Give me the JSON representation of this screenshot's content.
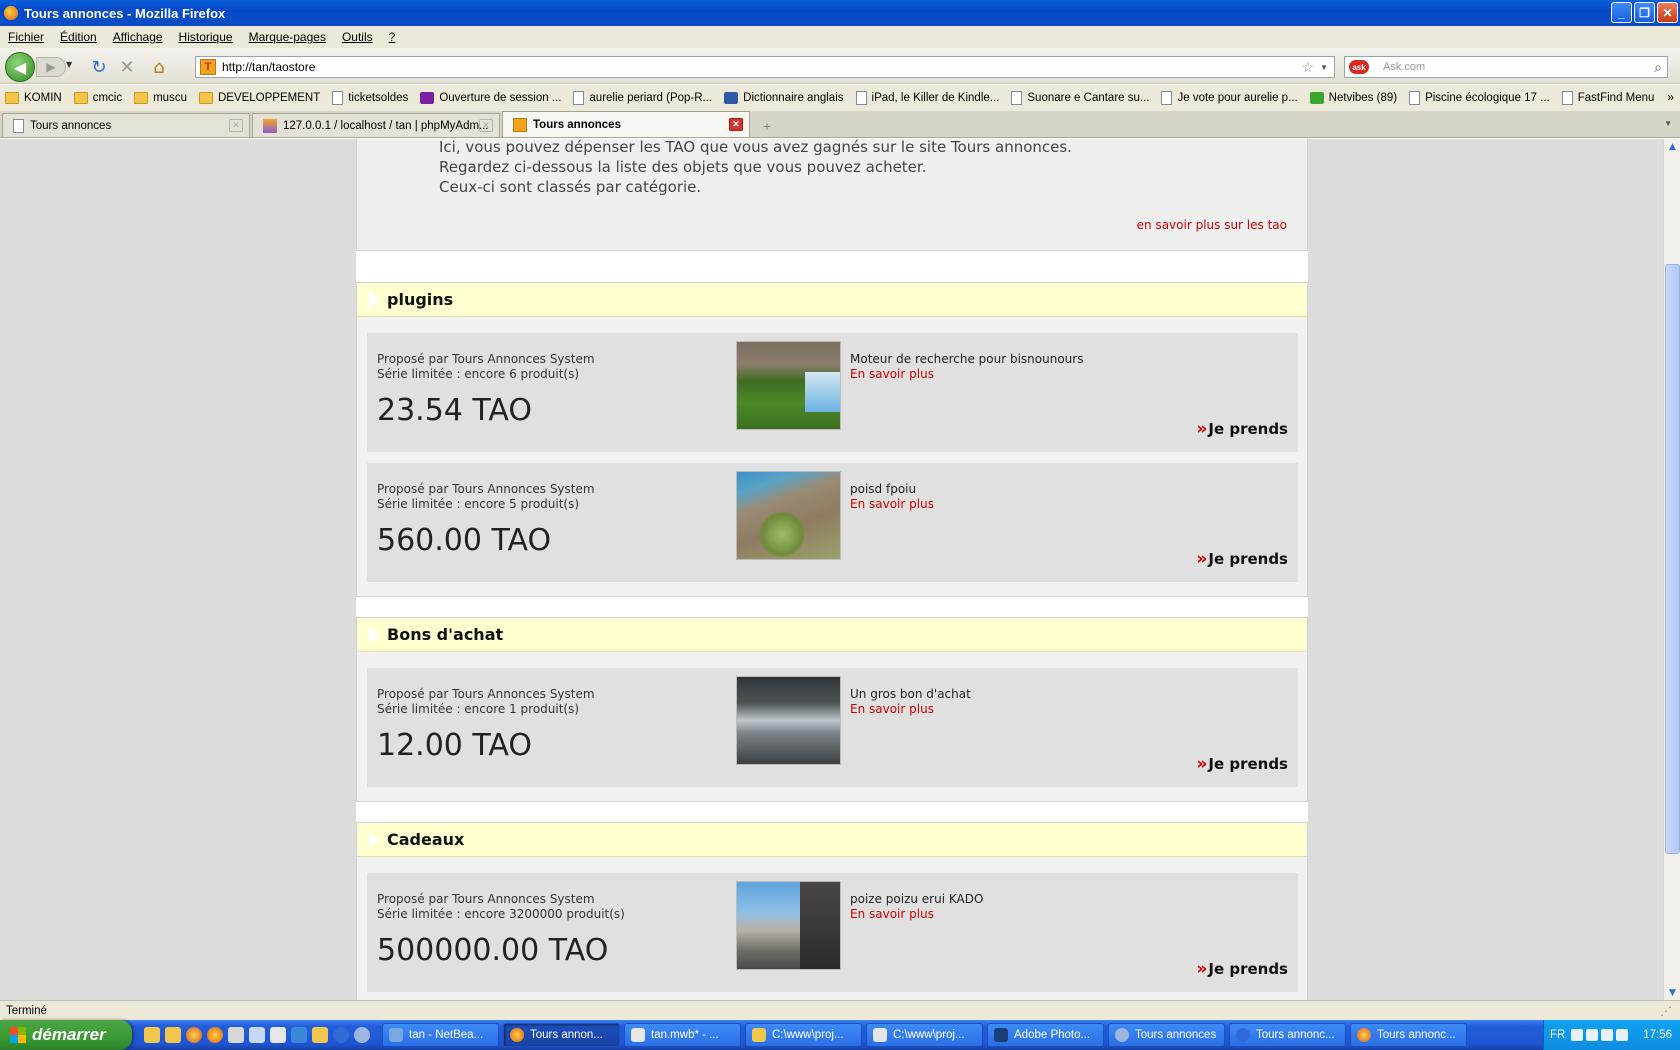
{
  "window": {
    "title": "Tours annonces - Mozilla Firefox"
  },
  "menu": [
    "Fichier",
    "Édition",
    "Affichage",
    "Historique",
    "Marque-pages",
    "Outils",
    "?"
  ],
  "nav": {
    "url": "http://tan/taostore",
    "search_placeholder": "Ask.com"
  },
  "bookmarks": [
    "KOMIN",
    "cmcic",
    "muscu",
    "DEVELOPPEMENT",
    "ticketsoldes",
    "Ouverture de session ...",
    "aurelie periard (Pop-R...",
    "Dictionnaire anglais",
    "iPad, le Killer de Kindle...",
    "Suonare e Cantare su...",
    "Je vote pour aurelie p...",
    "Netvibes (89)",
    "Piscine écologique 17 ...",
    "FastFind Menu"
  ],
  "tabs": [
    "Tours annonces",
    "127.0.0.1 / localhost / tan | phpMyAdm...",
    "Tours annonces"
  ],
  "intro": {
    "lines": [
      "Ici, vous pouvez dépenser les TAO que vous avez gagnés sur le site Tours annonces.",
      "Regardez ci-dessous la liste des objets que vous pouvez acheter.",
      "Ceux-ci sont classés par catégorie."
    ],
    "more_link": "en savoir plus sur les tao"
  },
  "categories": [
    {
      "title": "plugins",
      "items": [
        {
          "by": "Proposé par Tours Annonces System",
          "stock": "Série limitée : encore 6 produit(s)",
          "price": "23.54 TAO",
          "name": "Moteur de recherche pour bisnounours",
          "learn": "En savoir plus",
          "action": "Je prends"
        },
        {
          "by": "Proposé par Tours Annonces System",
          "stock": "Série limitée : encore 5 produit(s)",
          "price": "560.00 TAO",
          "name": "poisd fpoiu",
          "learn": "En savoir plus",
          "action": "Je prends"
        }
      ]
    },
    {
      "title": "Bons d'achat",
      "items": [
        {
          "by": "Proposé par Tours Annonces System",
          "stock": "Série limitée : encore 1 produit(s)",
          "price": "12.00 TAO",
          "name": "Un gros bon d'achat",
          "learn": "En savoir plus",
          "action": "Je prends"
        }
      ]
    },
    {
      "title": "Cadeaux",
      "items": [
        {
          "by": "Proposé par Tours Annonces System",
          "stock": "Série limitée : encore 3200000 produit(s)",
          "price": "500000.00 TAO",
          "name": "poize poizu erui KADO",
          "learn": "En savoir plus",
          "action": "Je prends"
        }
      ]
    }
  ],
  "status": "Terminé",
  "taskbar": {
    "start": "démarrer",
    "tasks": [
      "tan - NetBea...",
      "Tours annon...",
      "tan.mwb* - ...",
      "C:\\www\\proj...",
      "C:\\www\\proj...",
      "Adobe Photo...",
      "Tours annonces",
      "Tours annonc...",
      "Tours annonc..."
    ],
    "lang": "FR",
    "clock": "17:56"
  },
  "colors": {
    "accent_red": "#cc0000",
    "category_header": "#ffffd0",
    "item_bg": "#e0e0e0"
  }
}
